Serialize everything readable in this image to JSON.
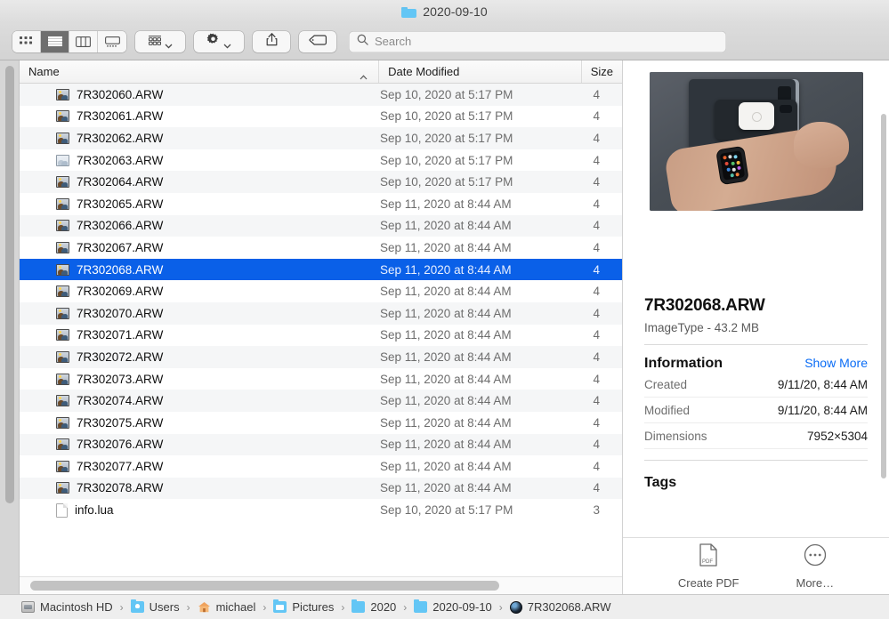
{
  "window": {
    "title": "2020-09-10",
    "title_icon": "folder-icon"
  },
  "toolbar": {
    "view_modes": [
      {
        "name": "icon-view",
        "label": "Icon View",
        "active": false
      },
      {
        "name": "list-view",
        "label": "List View",
        "active": true
      },
      {
        "name": "column-view",
        "label": "Column View",
        "active": false
      },
      {
        "name": "gallery-view",
        "label": "Gallery View",
        "active": false
      }
    ],
    "group_button": {
      "label": "Group Items",
      "icon": "grid-icon"
    },
    "action_button": {
      "label": "Action",
      "icon": "gear-icon"
    },
    "share_button": {
      "label": "Share",
      "icon": "share-icon"
    },
    "tag_button": {
      "label": "Tags",
      "icon": "tag-icon"
    }
  },
  "search": {
    "placeholder": "Search",
    "value": "",
    "icon": "search-icon"
  },
  "filelist": {
    "columns": [
      {
        "key": "name",
        "label": "Name",
        "sorted": "asc"
      },
      {
        "key": "date",
        "label": "Date Modified"
      },
      {
        "key": "size",
        "label": "Size"
      }
    ],
    "rows": [
      {
        "name": "7R302060.ARW",
        "date": "Sep 10, 2020 at 5:17 PM",
        "size": "4",
        "icon": "photo-icon",
        "selected": false
      },
      {
        "name": "7R302061.ARW",
        "date": "Sep 10, 2020 at 5:17 PM",
        "size": "4",
        "icon": "photo-icon",
        "selected": false
      },
      {
        "name": "7R302062.ARW",
        "date": "Sep 10, 2020 at 5:17 PM",
        "size": "4",
        "icon": "photo-icon",
        "selected": false
      },
      {
        "name": "7R302063.ARW",
        "date": "Sep 10, 2020 at 5:17 PM",
        "size": "4",
        "icon": "photo-icon-pale",
        "selected": false
      },
      {
        "name": "7R302064.ARW",
        "date": "Sep 10, 2020 at 5:17 PM",
        "size": "4",
        "icon": "photo-icon",
        "selected": false
      },
      {
        "name": "7R302065.ARW",
        "date": "Sep 11, 2020 at 8:44 AM",
        "size": "4",
        "icon": "photo-icon",
        "selected": false
      },
      {
        "name": "7R302066.ARW",
        "date": "Sep 11, 2020 at 8:44 AM",
        "size": "4",
        "icon": "photo-icon",
        "selected": false
      },
      {
        "name": "7R302067.ARW",
        "date": "Sep 11, 2020 at 8:44 AM",
        "size": "4",
        "icon": "photo-icon",
        "selected": false
      },
      {
        "name": "7R302068.ARW",
        "date": "Sep 11, 2020 at 8:44 AM",
        "size": "4",
        "icon": "photo-icon",
        "selected": true
      },
      {
        "name": "7R302069.ARW",
        "date": "Sep 11, 2020 at 8:44 AM",
        "size": "4",
        "icon": "photo-icon",
        "selected": false
      },
      {
        "name": "7R302070.ARW",
        "date": "Sep 11, 2020 at 8:44 AM",
        "size": "4",
        "icon": "photo-icon",
        "selected": false
      },
      {
        "name": "7R302071.ARW",
        "date": "Sep 11, 2020 at 8:44 AM",
        "size": "4",
        "icon": "photo-icon",
        "selected": false
      },
      {
        "name": "7R302072.ARW",
        "date": "Sep 11, 2020 at 8:44 AM",
        "size": "4",
        "icon": "photo-icon",
        "selected": false
      },
      {
        "name": "7R302073.ARW",
        "date": "Sep 11, 2020 at 8:44 AM",
        "size": "4",
        "icon": "photo-icon",
        "selected": false
      },
      {
        "name": "7R302074.ARW",
        "date": "Sep 11, 2020 at 8:44 AM",
        "size": "4",
        "icon": "photo-icon",
        "selected": false
      },
      {
        "name": "7R302075.ARW",
        "date": "Sep 11, 2020 at 8:44 AM",
        "size": "4",
        "icon": "photo-icon",
        "selected": false
      },
      {
        "name": "7R302076.ARW",
        "date": "Sep 11, 2020 at 8:44 AM",
        "size": "4",
        "icon": "photo-icon",
        "selected": false
      },
      {
        "name": "7R302077.ARW",
        "date": "Sep 11, 2020 at 8:44 AM",
        "size": "4",
        "icon": "photo-icon",
        "selected": false
      },
      {
        "name": "7R302078.ARW",
        "date": "Sep 11, 2020 at 8:44 AM",
        "size": "4",
        "icon": "photo-icon",
        "selected": false
      },
      {
        "name": "info.lua",
        "date": "Sep 10, 2020 at 5:17 PM",
        "size": "3",
        "icon": "document-icon",
        "selected": false
      }
    ]
  },
  "preview": {
    "filename": "7R302068.ARW",
    "subtitle": "ImageType - 43.2 MB",
    "information_label": "Information",
    "show_more_label": "Show More",
    "fields": [
      {
        "label": "Created",
        "value": "9/11/20, 8:44 AM"
      },
      {
        "label": "Modified",
        "value": "9/11/20, 8:44 AM"
      },
      {
        "label": "Dimensions",
        "value": "7952×5304"
      }
    ],
    "tags_label": "Tags",
    "actions": [
      {
        "label": "Create PDF",
        "icon": "pdf-icon"
      },
      {
        "label": "More…",
        "icon": "ellipsis-circle-icon"
      }
    ]
  },
  "pathbar": {
    "crumbs": [
      {
        "label": "Macintosh HD",
        "icon": "drive-icon"
      },
      {
        "label": "Users",
        "icon": "users-folder-icon"
      },
      {
        "label": "michael",
        "icon": "home-icon"
      },
      {
        "label": "Pictures",
        "icon": "pictures-folder-icon"
      },
      {
        "label": "2020",
        "icon": "folder-icon"
      },
      {
        "label": "2020-09-10",
        "icon": "folder-icon"
      },
      {
        "label": "7R302068.ARW",
        "icon": "raw-image-icon"
      }
    ],
    "separator": "›"
  },
  "colors": {
    "selection": "#0a60e8",
    "link": "#0a6cf5",
    "folder": "#63c6f5"
  }
}
